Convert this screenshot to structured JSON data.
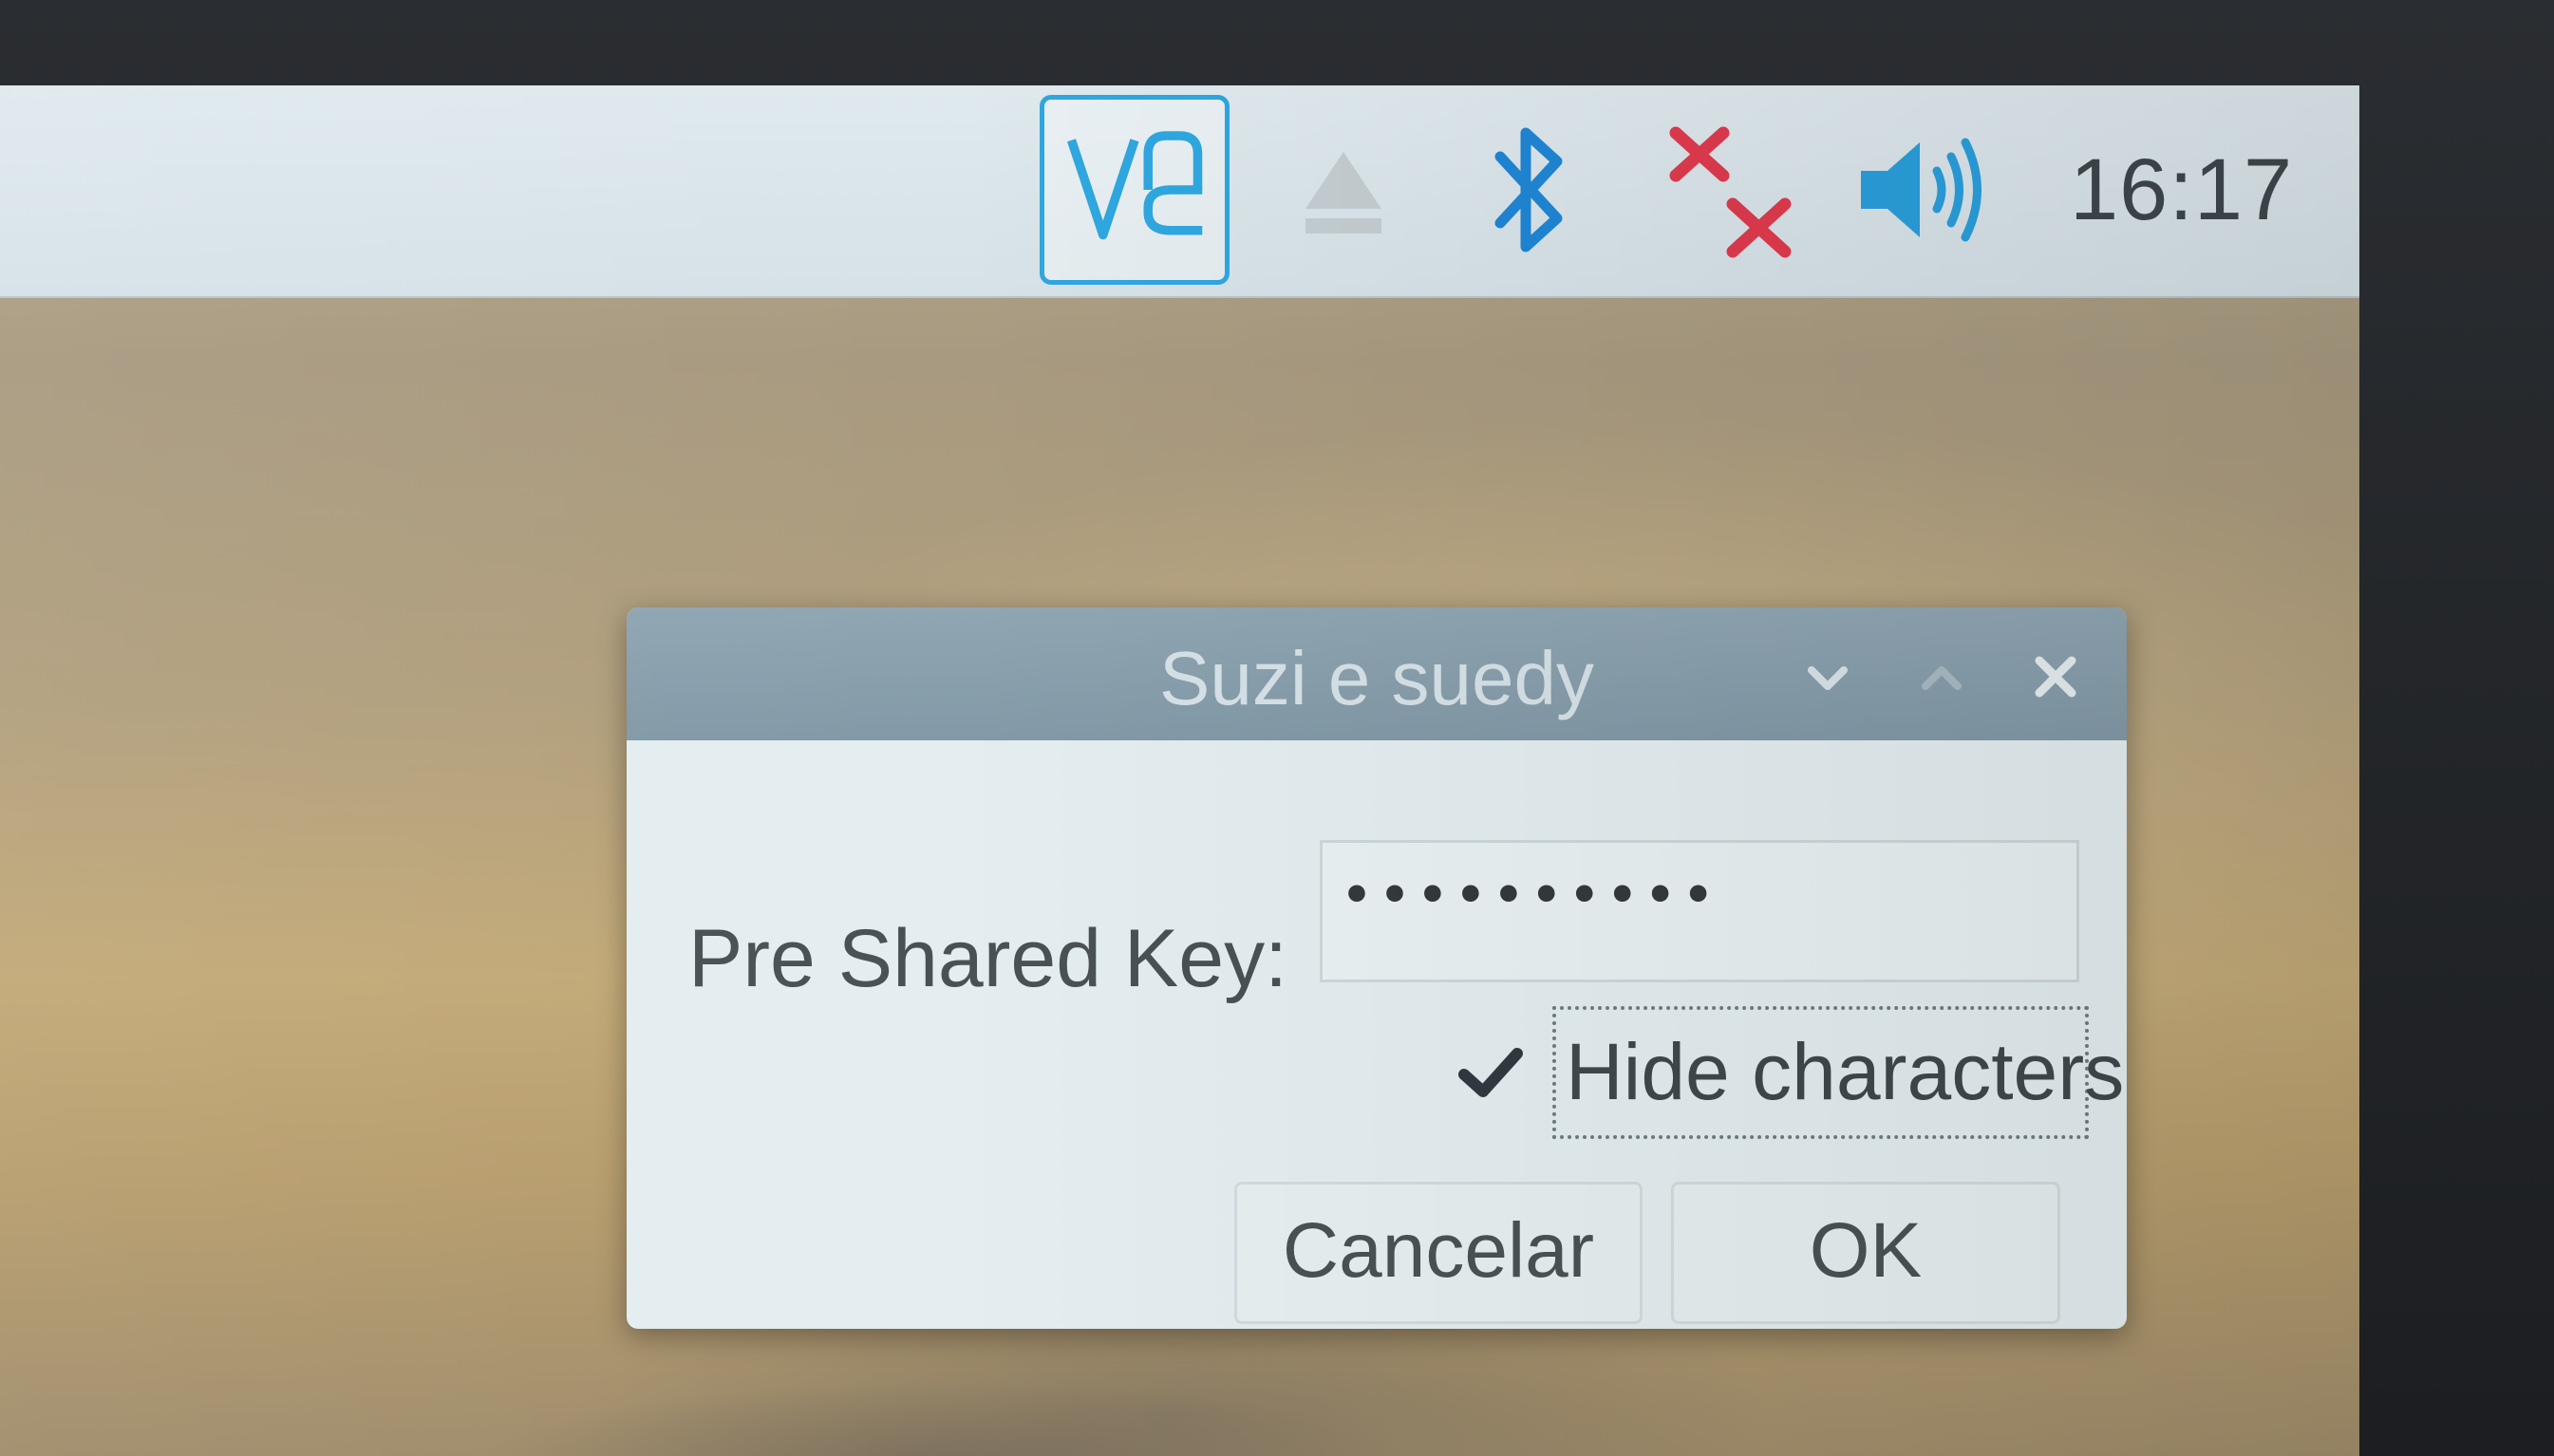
{
  "taskbar": {
    "icons": {
      "vnc": "vnc-icon",
      "eject": "eject-icon",
      "bluetooth": "bluetooth-icon",
      "network": "network-disconnected-icon",
      "volume": "volume-icon"
    },
    "clock": "16:17"
  },
  "dialog": {
    "title": "Suzi e suedy",
    "psk_label": "Pre Shared Key:",
    "psk_value": "••••••••••",
    "hide_characters_label": "Hide characters",
    "hide_characters_checked": true,
    "cancel_label": "Cancelar",
    "ok_label": "OK"
  },
  "colors": {
    "vnc_accent": "#2ea7e0",
    "bluetooth": "#1f86d6",
    "network_error": "#e03b4e",
    "volume": "#2a9fdc",
    "titlebar": "#8a9fad"
  }
}
